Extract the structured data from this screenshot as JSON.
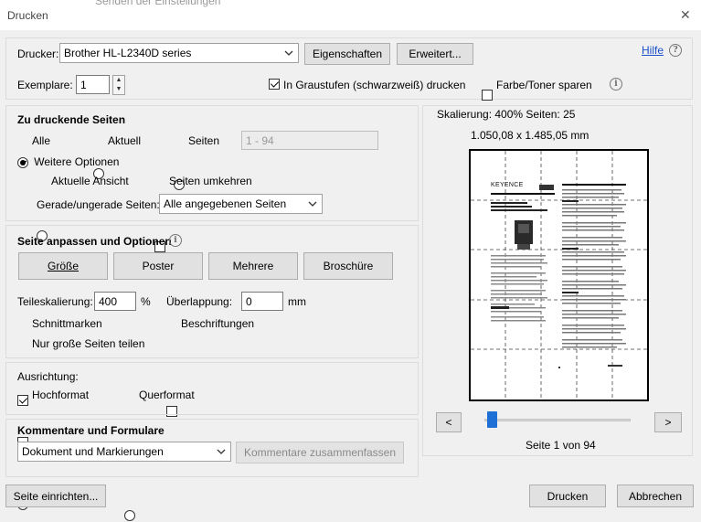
{
  "window": {
    "title": "Drucken",
    "behind_text": "Senden der Einstellungen",
    "close_glyph": "✕"
  },
  "printer": {
    "label": "Drucker:",
    "selected": "Brother HL-L2340D series",
    "properties_label": "Eigenschaften",
    "advanced_label": "Erweitert...",
    "help_label": "Hilfe",
    "copies_label": "Exemplare:",
    "copies_value": "1",
    "grayscale_label": "In Graustufen (schwarzweiß) drucken",
    "grayscale_checked": true,
    "save_toner_label": "Farbe/Toner sparen",
    "save_toner_checked": false
  },
  "pages": {
    "heading": "Zu druckende Seiten",
    "all_label": "Alle",
    "current_label": "Aktuell",
    "pages_label": "Seiten",
    "range_value": "1 - 94",
    "more_options_label": "Weitere Optionen",
    "current_view_label": "Aktuelle Ansicht",
    "reverse_label": "Seiten umkehren",
    "odd_even_label": "Gerade/ungerade Seiten:",
    "odd_even_value": "Alle angegebenen Seiten"
  },
  "sizing": {
    "heading": "Seite anpassen und Optionen",
    "size_btn": "Größe",
    "poster_btn": "Poster",
    "multiple_btn": "Mehrere",
    "brochure_btn": "Broschüre",
    "tile_scale_label": "Teileskalierung:",
    "tile_scale_value": "400",
    "percent_unit": "%",
    "overlap_label": "Überlappung:",
    "overlap_value": "0",
    "mm_unit": "mm",
    "cut_marks_label": "Schnittmarken",
    "labels_label": "Beschriftungen",
    "large_pages_label": "Nur große Seiten teilen"
  },
  "orientation": {
    "heading": "Ausrichtung:",
    "portrait_label": "Hochformat",
    "landscape_label": "Querformat"
  },
  "comments": {
    "heading": "Kommentare und Formulare",
    "value": "Dokument und Markierungen",
    "summarize_btn": "Kommentare zusammenfassen"
  },
  "preview": {
    "scaling_text": "Skalierung: 400% Seiten: 25",
    "dimensions_text": "1.050,08 x 1.485,05 mm",
    "prev_btn": "<",
    "next_btn": ">",
    "page_status": "Seite 1 von 94",
    "slider_position": 0.02,
    "doc_brand": "KEYENCE"
  },
  "footer": {
    "page_setup_btn": "Seite einrichten...",
    "print_btn": "Drucken",
    "cancel_btn": "Abbrechen"
  },
  "colors": {
    "dialog_bg": "#f0f0f0",
    "link": "#1a4fc9",
    "slider_thumb": "#1e6fd6"
  }
}
